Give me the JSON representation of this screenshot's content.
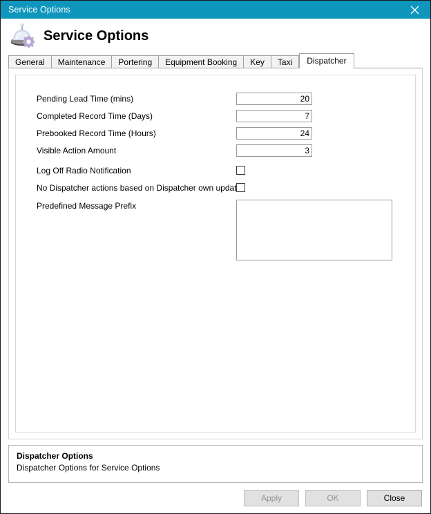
{
  "window": {
    "title": "Service Options",
    "close_icon": "close-icon"
  },
  "header": {
    "title": "Service Options",
    "icon": "service-bell-gear-icon"
  },
  "tabs": [
    {
      "label": "General",
      "active": false
    },
    {
      "label": "Maintenance",
      "active": false
    },
    {
      "label": "Portering",
      "active": false
    },
    {
      "label": "Equipment Booking",
      "active": false
    },
    {
      "label": "Key",
      "active": false
    },
    {
      "label": "Taxi",
      "active": false
    },
    {
      "label": "Dispatcher",
      "active": true
    }
  ],
  "form": {
    "fields": [
      {
        "label": "Pending Lead Time (mins)",
        "type": "number",
        "value": "20"
      },
      {
        "label": "Completed Record Time (Days)",
        "type": "number",
        "value": "7"
      },
      {
        "label": "Prebooked Record Time (Hours)",
        "type": "number",
        "value": "24"
      },
      {
        "label": "Visible Action Amount",
        "type": "number",
        "value": "3"
      },
      {
        "label": "Log Off Radio Notification",
        "type": "checkbox",
        "checked": false
      },
      {
        "label": "No Dispatcher actions based on Dispatcher own updates",
        "type": "checkbox",
        "checked": false
      },
      {
        "label": "Predefined Message Prefix",
        "type": "textarea",
        "value": ""
      }
    ]
  },
  "description": {
    "title": "Dispatcher Options",
    "subtitle": "Dispatcher Options for Service Options"
  },
  "footer": {
    "buttons": [
      {
        "label": "Apply",
        "enabled": false
      },
      {
        "label": "OK",
        "enabled": false
      },
      {
        "label": "Close",
        "enabled": true
      }
    ]
  },
  "colors": {
    "titlebar": "#0f96bd",
    "titlebar_text": "#ffffff",
    "button_face": "#e1e1e1",
    "disabled_text": "#949494"
  }
}
